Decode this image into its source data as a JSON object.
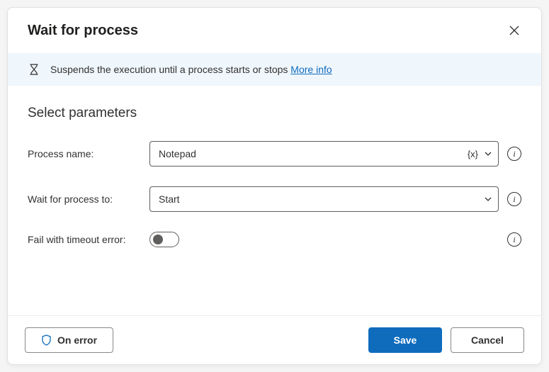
{
  "header": {
    "title": "Wait for process"
  },
  "banner": {
    "text": "Suspends the execution until a process starts or stops ",
    "link": "More info"
  },
  "section": {
    "title": "Select parameters"
  },
  "fields": {
    "process_name": {
      "label": "Process name:",
      "value": "Notepad"
    },
    "wait_for": {
      "label": "Wait for process to:",
      "value": "Start"
    },
    "fail_timeout": {
      "label": "Fail with timeout error:",
      "value": false
    }
  },
  "footer": {
    "on_error": "On error",
    "save": "Save",
    "cancel": "Cancel"
  }
}
